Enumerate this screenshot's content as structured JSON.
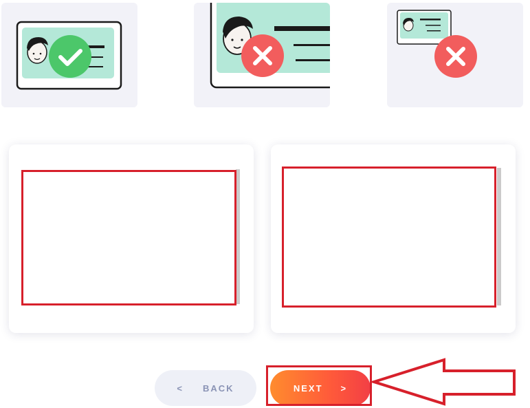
{
  "examples": [
    {
      "status": "accepted",
      "icon": "check-icon",
      "color": "#4cc76a"
    },
    {
      "status": "rejected",
      "icon": "close-icon",
      "color": "#f25d5d"
    },
    {
      "status": "rejected",
      "icon": "close-icon",
      "color": "#f25d5d"
    }
  ],
  "navigation": {
    "back_chevron": "<",
    "back_label": "BACK",
    "next_label": "NEXT",
    "next_chevron": ">"
  },
  "colors": {
    "card_bg": "#f2f2f8",
    "id_card_fill": "#b4e8d8",
    "highlight": "#d7202b",
    "next_gradient_start": "#ff8c2e",
    "next_gradient_end": "#f23f45"
  }
}
